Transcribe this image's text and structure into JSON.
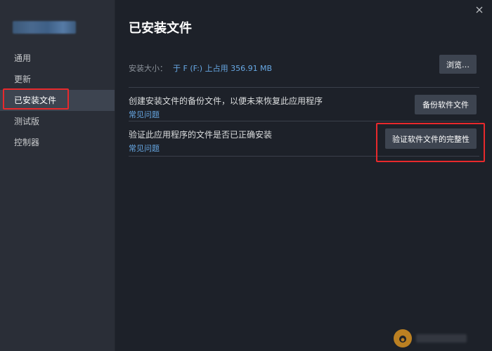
{
  "sidebar": {
    "items": [
      {
        "label": "通用"
      },
      {
        "label": "更新"
      },
      {
        "label": "已安装文件",
        "selected": true
      },
      {
        "label": "测试版"
      },
      {
        "label": "控制器"
      }
    ]
  },
  "main": {
    "title": "已安装文件",
    "install_size": {
      "label": "安装大小：",
      "value": "于 F (F:) 上占用 356.91 MB",
      "browse_button": "浏览…"
    },
    "backup": {
      "description": "创建安装文件的备份文件，以便未来恢复此应用程序",
      "faq": "常见问题",
      "button": "备份软件文件"
    },
    "verify": {
      "description": "验证此应用程序的文件是否已正确安装",
      "faq": "常见问题",
      "button": "验证软件文件的完整性"
    }
  },
  "colors": {
    "background": "#1d2129",
    "sidebar": "#2a2e37",
    "selected": "#3d4450",
    "link": "#67a8e4",
    "highlight": "#e8292c"
  },
  "icons": {
    "close": "close-icon",
    "watermark": "watermark-logo-icon"
  }
}
